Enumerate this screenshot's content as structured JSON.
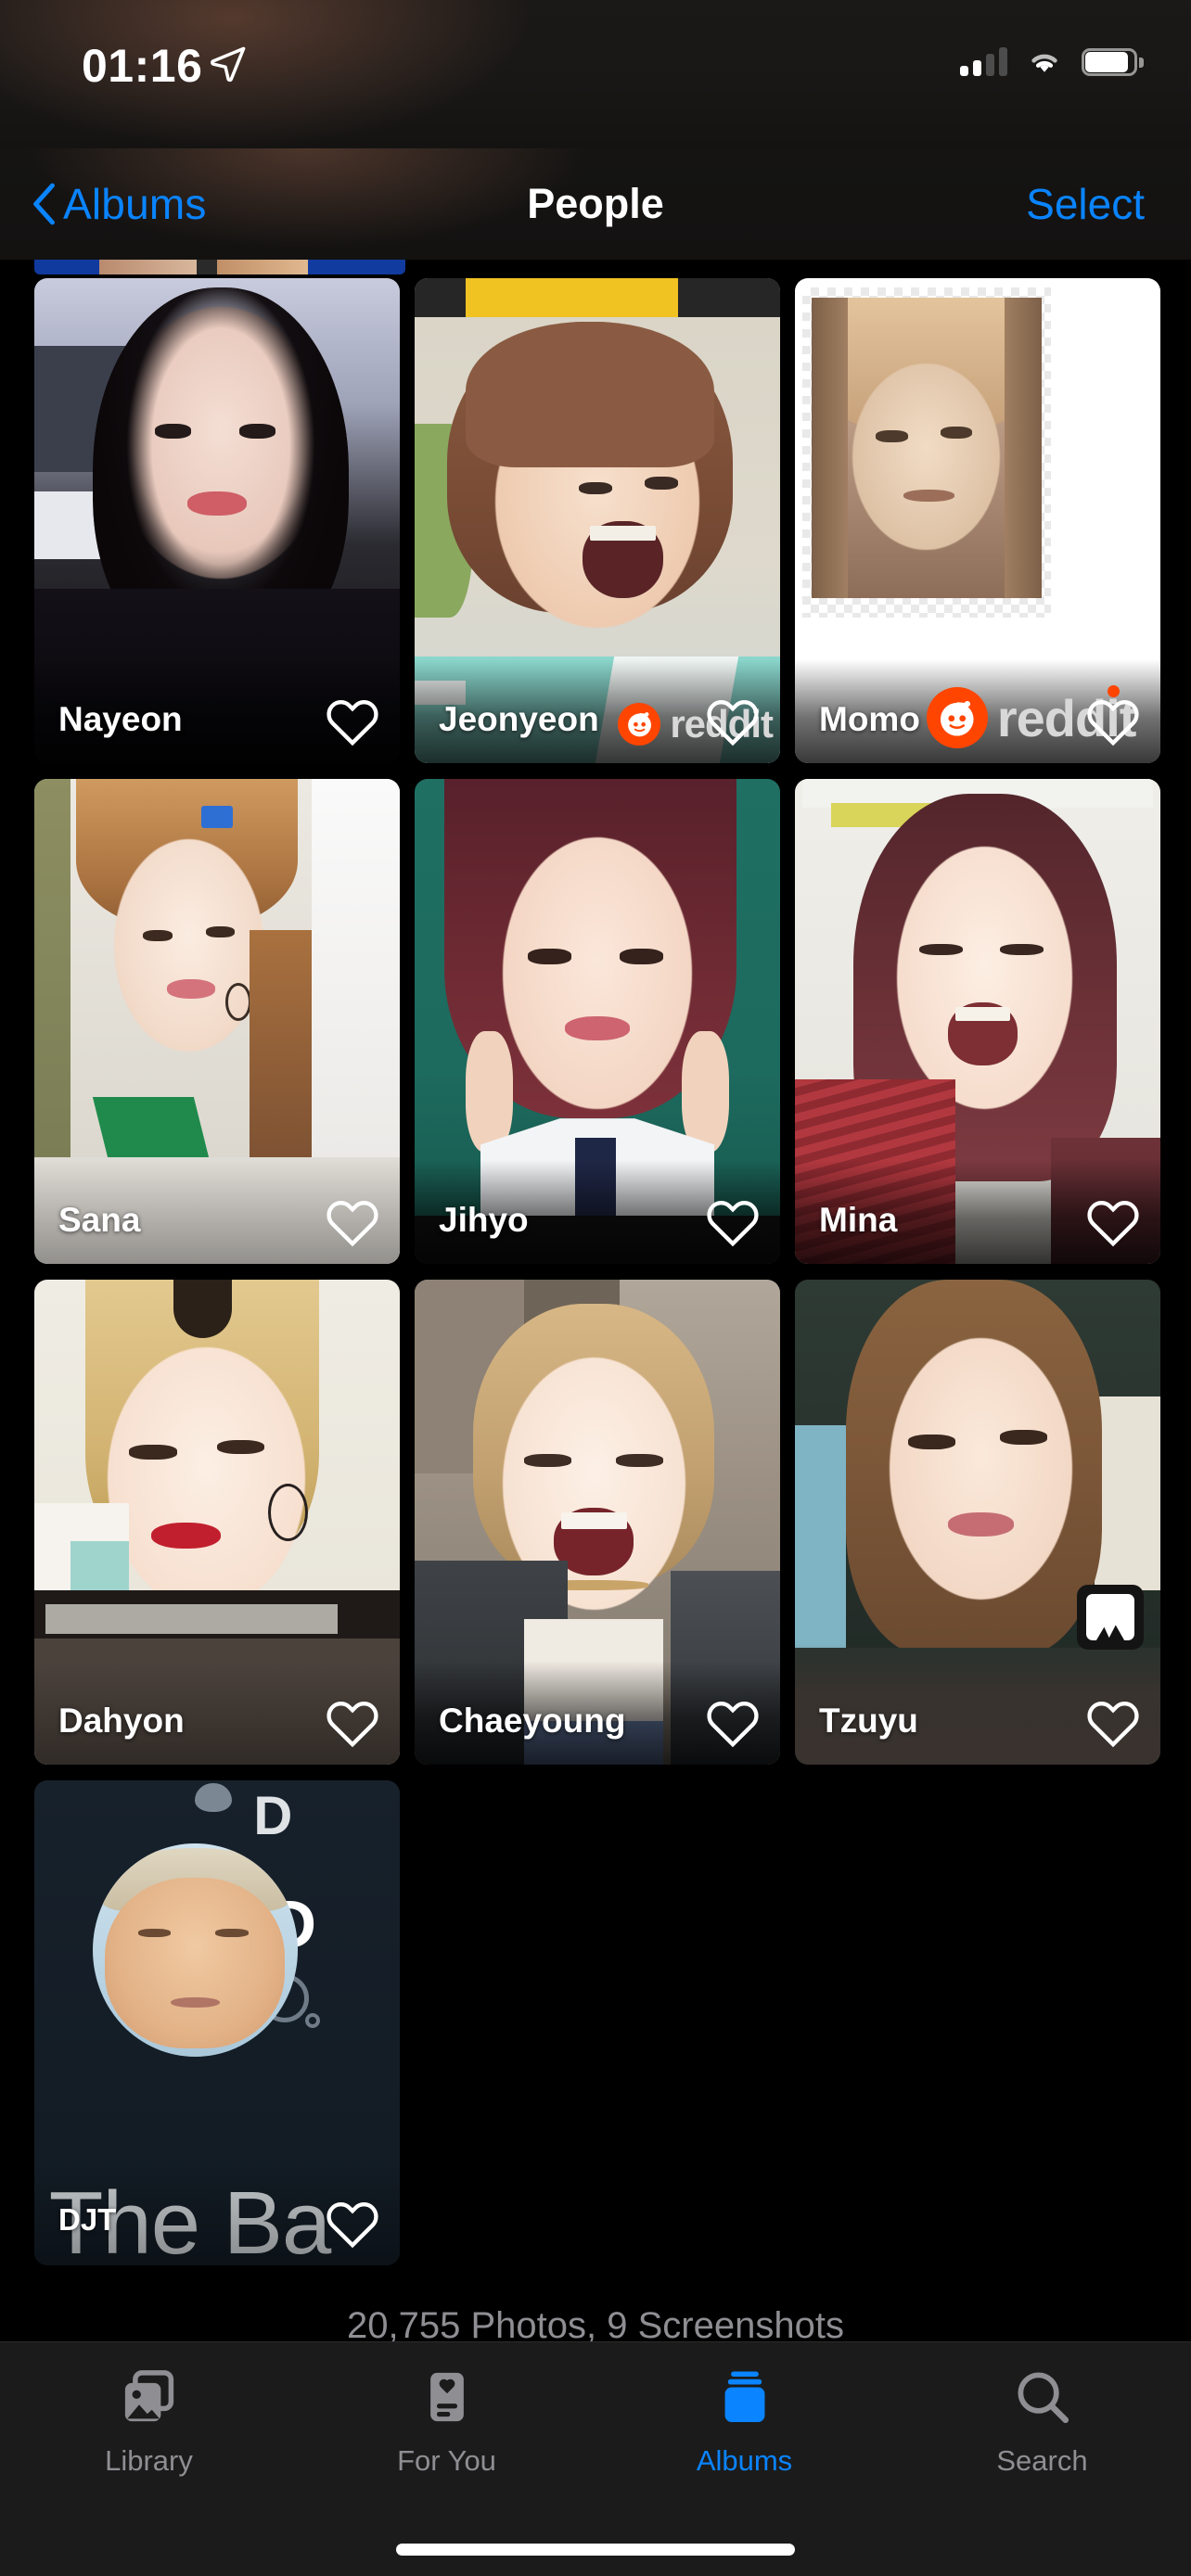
{
  "status_bar": {
    "time": "01:16",
    "location_icon": "location-arrow-icon",
    "signal_icon": "cellular-signal-icon",
    "signal_bars_filled": 2,
    "signal_bars_total": 4,
    "wifi_icon": "wifi-icon",
    "battery_icon": "battery-icon",
    "battery_level_percent": 92
  },
  "nav_bar": {
    "back_icon": "chevron-left-icon",
    "back_label": "Albums",
    "title": "People",
    "select_label": "Select"
  },
  "people": [
    {
      "name": "Nayeon",
      "favorite_icon": "heart-outline-icon",
      "favorited": false,
      "watermark": null
    },
    {
      "name": "Jeonyeon",
      "favorite_icon": "heart-outline-icon",
      "favorited": false,
      "watermark": "reddit"
    },
    {
      "name": "Momo",
      "favorite_icon": "heart-outline-icon",
      "favorited": false,
      "watermark": "reddit"
    },
    {
      "name": "Sana",
      "favorite_icon": "heart-outline-icon",
      "favorited": false,
      "watermark": null
    },
    {
      "name": "Jihyo",
      "favorite_icon": "heart-outline-icon",
      "favorited": false,
      "watermark": null
    },
    {
      "name": "Mina",
      "favorite_icon": "heart-outline-icon",
      "favorited": false,
      "watermark": null
    },
    {
      "name": "Dahyon",
      "favorite_icon": "heart-outline-icon",
      "favorited": false,
      "watermark": null
    },
    {
      "name": "Chaeyoung",
      "favorite_icon": "heart-outline-icon",
      "favorited": false,
      "watermark": null
    },
    {
      "name": "Tzuyu",
      "favorite_icon": "heart-outline-icon",
      "favorited": false,
      "watermark": "photos-badge"
    },
    {
      "name": "DJT",
      "favorite_icon": "heart-outline-icon",
      "favorited": false,
      "watermark": null,
      "photo_overlay_text": "The Ba"
    }
  ],
  "library_footer": {
    "count_text": "20,755 Photos, 9 Screenshots"
  },
  "tab_bar": {
    "items": [
      {
        "label": "Library",
        "icon": "photos-library-icon",
        "active": false
      },
      {
        "label": "For You",
        "icon": "for-you-card-icon",
        "active": false
      },
      {
        "label": "Albums",
        "icon": "albums-stack-icon",
        "active": true
      },
      {
        "label": "Search",
        "icon": "magnifier-icon",
        "active": false
      }
    ]
  },
  "colors": {
    "accent": "#0a84ff",
    "background": "#000000",
    "tab_bar": "#1b1b1b",
    "secondary_text": "#8e8e93",
    "reddit_orange": "#ff4500"
  }
}
